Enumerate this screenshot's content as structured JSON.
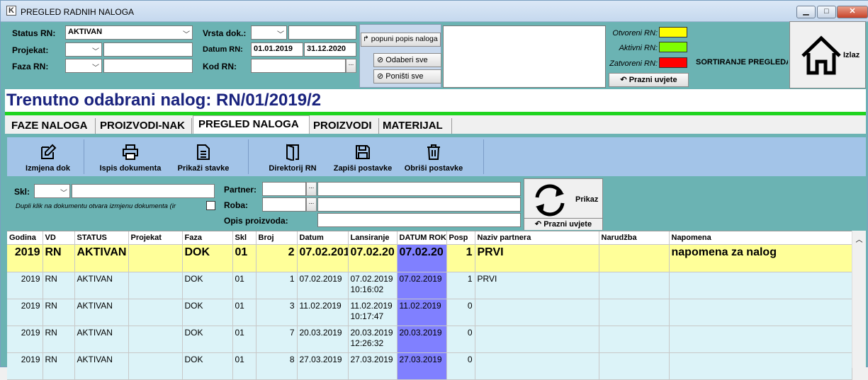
{
  "window": {
    "title": "PREGLED RADNIH NALOGA",
    "min": "▁",
    "max": "□",
    "close": "✕"
  },
  "filters": {
    "status_label": "Status RN:",
    "status_value": "AKTIVAN",
    "projekat_label": "Projekat:",
    "faza_label": "Faza RN:",
    "vrsta_label": "Vrsta dok.:",
    "datum_label": "Datum RN:",
    "datum_od": "01.01.2019",
    "datum_do": "31.12.2020",
    "kod_label": "Kod RN:",
    "ellipsis": "...",
    "popuni_label": "popuni popis naloga",
    "odaberi_label": "Odaberi sve",
    "ponisti_label": "Poništi sve"
  },
  "legend": {
    "otvoreni": "Otvoreni RN:",
    "aktivni": "Aktivni RN:",
    "zatvoreni": "Zatvoreni RN:",
    "otvoreni_color": "#ffff00",
    "aktivni_color": "#80ff00",
    "zatvoreni_color": "#ff0000",
    "prazni_label": "Prazni uvjete",
    "sortiranje_label": "SORTIRANJE PREGLEDA"
  },
  "exit": {
    "label": "Izlaz",
    "icon": "home-icon"
  },
  "current": {
    "title": "Trenutno odabrani nalog: RN/01/2019/2"
  },
  "tabs": [
    "FAZE NALOGA",
    "PROIZVODI-NAK",
    "PREGLED NALOGA",
    "PROIZVODI",
    "MATERIJAL"
  ],
  "toolbar": {
    "izmjena": "Izmjena dok",
    "ispis": "Ispis dokumenta",
    "prikazi": "Prikaži stavke",
    "direktorij": "Direktorij RN",
    "zapisi": "Zapiši postavke",
    "obrisi": "Obriši postavke"
  },
  "search": {
    "skl_label": "Skl:",
    "hint": "Dupli klik na dokumentu otvara izmjenu dokumenta (ir",
    "partner_label": "Partner:",
    "roba_label": "Roba:",
    "opis_label": "Opis proizvoda:",
    "prikaz_label": "Prikaz",
    "prazni_label": "Prazni uvjete"
  },
  "grid": {
    "columns": [
      "Godina",
      "VD",
      "STATUS",
      "Projekat",
      "Faza",
      "Skl",
      "Broj",
      "Datum",
      "Lansiranje",
      "DATUM ROK",
      "Posp",
      "Naziv partnera",
      "Narudžba",
      "Napomena"
    ],
    "rows": [
      {
        "godina": "2019",
        "vd": "RN",
        "status": "AKTIVAN",
        "projekat": "",
        "faza": "DOK",
        "skl": "01",
        "broj": "2",
        "datum": "07.02.201",
        "lans1": "07.02.20",
        "lans2": "",
        "rok": "07.02.20",
        "posp": "1",
        "partner": "PRVI",
        "narudzba": "",
        "napomena": "napomena za nalog"
      },
      {
        "godina": "2019",
        "vd": "RN",
        "status": "AKTIVAN",
        "projekat": "",
        "faza": "DOK",
        "skl": "01",
        "broj": "1",
        "datum": "07.02.2019",
        "lans1": "07.02.2019",
        "lans2": "10:16:02",
        "rok": "07.02.2019",
        "posp": "1",
        "partner": "PRVI",
        "narudzba": "",
        "napomena": ""
      },
      {
        "godina": "2019",
        "vd": "RN",
        "status": "AKTIVAN",
        "projekat": "",
        "faza": "DOK",
        "skl": "01",
        "broj": "3",
        "datum": "11.02.2019",
        "lans1": "11.02.2019",
        "lans2": "10:17:47",
        "rok": "11.02.2019",
        "posp": "0",
        "partner": "",
        "narudzba": "",
        "napomena": ""
      },
      {
        "godina": "2019",
        "vd": "RN",
        "status": "AKTIVAN",
        "projekat": "",
        "faza": "DOK",
        "skl": "01",
        "broj": "7",
        "datum": "20.03.2019",
        "lans1": "20.03.2019",
        "lans2": "12:26:32",
        "rok": "20.03.2019",
        "posp": "0",
        "partner": "",
        "narudzba": "",
        "napomena": ""
      },
      {
        "godina": "2019",
        "vd": "RN",
        "status": "AKTIVAN",
        "projekat": "",
        "faza": "DOK",
        "skl": "01",
        "broj": "8",
        "datum": "27.03.2019",
        "lans1": "27.03.2019",
        "lans2": "",
        "rok": "27.03.2019",
        "posp": "0",
        "partner": "",
        "narudzba": "",
        "napomena": ""
      }
    ]
  }
}
